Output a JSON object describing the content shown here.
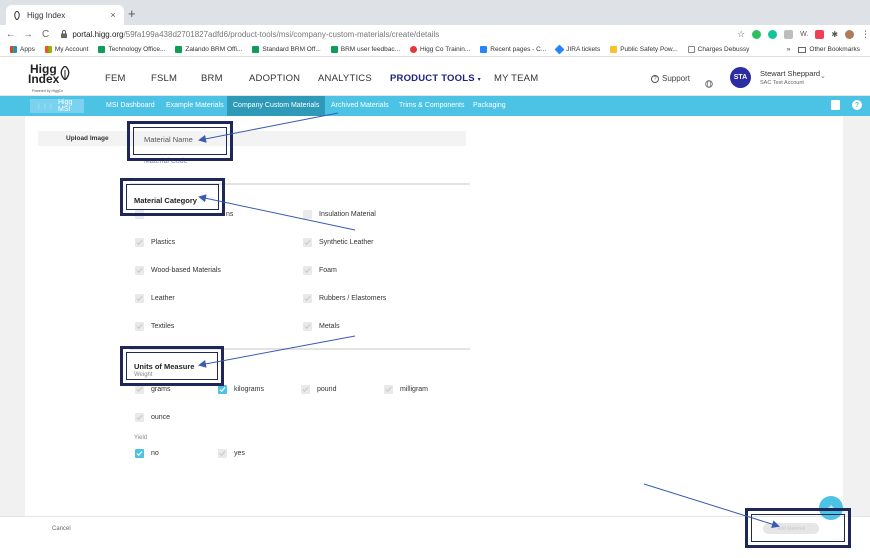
{
  "browser": {
    "tab_title": "Higg Index",
    "close_glyph": "×",
    "new_tab_glyph": "+",
    "url_host": "portal.higg.org",
    "url_path": "/59fa199a438d2701827adfd6/product-tools/msi/company-custom-materials/create/details",
    "ext_label": "W.",
    "bookmarks": [
      "Apps",
      "My Account",
      "Technology Office...",
      "Zalando BRM Offi...",
      "Standard BRM Off...",
      "BRM user feedbac...",
      "Higg Co Trainin...",
      "Recent pages - C...",
      "JIRA tickets",
      "Public Safety Pow...",
      "Charges Debussy"
    ],
    "more_bookmarks": "»",
    "other_bookmarks": "Other Bookmarks"
  },
  "logo": {
    "line1": "Higg",
    "line2": "Index",
    "powered": "Powered by HiggCo"
  },
  "nav": {
    "items": [
      "FEM",
      "FSLM",
      "BRM",
      "ADOPTION",
      "ANALYTICS",
      "PRODUCT TOOLS",
      "MY TEAM"
    ],
    "support": "Support"
  },
  "user": {
    "initials": "STA",
    "name": "Stewart Sheppard",
    "org": "SAC Test Account"
  },
  "subnav": {
    "brand": "Higg MSI",
    "items": [
      "MSI Dashboard",
      "Example Materials",
      "Company Custom Materials",
      "Archived Materials",
      "Trims & Components",
      "Packaging"
    ]
  },
  "form": {
    "upload_label": "Upload Image",
    "material_name_placeholder": "Material Name",
    "material_code_placeholder": "Material Code",
    "category_title": "Material Category",
    "categories": [
      {
        "label": "ns",
        "checked": false
      },
      {
        "label": "Insulation Material",
        "checked": false
      },
      {
        "label": "Plastics",
        "checked": false
      },
      {
        "label": "Synthetic Leather",
        "checked": false
      },
      {
        "label": "Wood-based Materials",
        "checked": false
      },
      {
        "label": "Foam",
        "checked": false
      },
      {
        "label": "Leather",
        "checked": false
      },
      {
        "label": "Rubbers / Elastomers",
        "checked": false
      },
      {
        "label": "Textiles",
        "checked": false
      },
      {
        "label": "Metals",
        "checked": false
      }
    ],
    "units_title": "Units of Measure",
    "weight_label": "Weight",
    "weight_units": [
      {
        "label": "grams",
        "checked": false
      },
      {
        "label": "kilograms",
        "checked": true
      },
      {
        "label": "pound",
        "checked": false
      },
      {
        "label": "milligram",
        "checked": false
      },
      {
        "label": "ounce",
        "checked": false
      }
    ],
    "yield_label": "Yield",
    "yield_options": [
      {
        "label": "no",
        "checked": true
      },
      {
        "label": "yes",
        "checked": false
      }
    ]
  },
  "footer": {
    "cancel": "Cancel",
    "add_button": "Add Material"
  },
  "fab_glyph": "+",
  "colors": {
    "accent": "#4cc3e5",
    "accent_dark": "#2f9ab8",
    "nav_active": "#1a237e",
    "avatar": "#2c2ca3",
    "callout": "#1e2757",
    "arrow": "#3a5bb3"
  }
}
